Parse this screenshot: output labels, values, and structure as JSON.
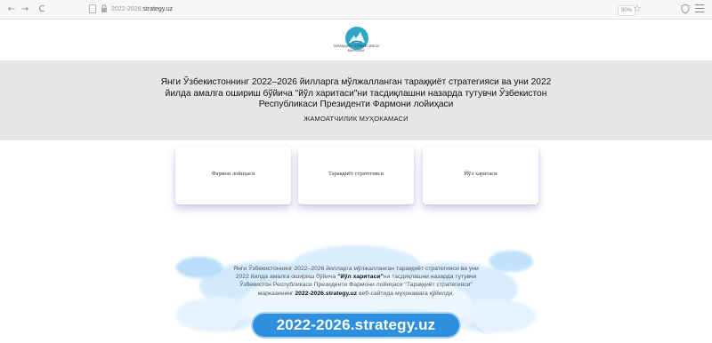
{
  "browser": {
    "address_prefix": "2022-2026.",
    "address_domain": "strategy.uz",
    "zoom": "80%",
    "nav_back": "←",
    "nav_forward": "→",
    "nav_reload": "C",
    "star": "☆",
    "icons": [
      "back-arrow-icon",
      "forward-arrow-icon",
      "reload-icon",
      "page-icon",
      "lock-icon",
      "star-icon",
      "shield-icon",
      "menu-icon"
    ]
  },
  "header": {
    "logo_line1": "ТАРАҚҚИЁТ СТРАТЕГИЯСИ",
    "logo_line2": "МАРКАЗИ"
  },
  "banner": {
    "title": "Янги Ўзбекистоннинг 2022–2026 йилларга мўлжалланган тараққиёт стратегияси ва уни 2022 йилда амалга ошириш бўйича \"йўл харитаси\"ни тасдиқлашни назарда тутувчи Ўзбекистон Республикаси Президенти Фармони лойиҳаси",
    "subtitle": "ЖАМОАТЧИЛИК МУҲОКАМАСИ"
  },
  "cards": [
    {
      "label": "Фармон лойиҳаси"
    },
    {
      "label": "Тараққиёт стратегияси"
    },
    {
      "label": "Йўл харитаси"
    }
  ],
  "promo": {
    "line1": "Янги Ўзбекистоннинг 2022–2026 йилларга мўлжалланган тараққиёт стратегияси ва уни",
    "line2_prefix": "2022 йилда амалга ошириш бўйича ",
    "line2_bold": "\"йўл харитаси\"",
    "line2_suffix": "ни тасдиқлашни назарда тутувчи",
    "line3": "Ўзбекистон Республикаси Президенти Фармони лойиҳаси \"Тараққиёт стратегияси\"",
    "line4_prefix": "марказининг ",
    "line4_bold": "2022-2026.strategy.uz",
    "line4_suffix": " веб-сайтида муҳокамага қўйилди.",
    "domain": "2022-2026.strategy.uz"
  },
  "colors": {
    "banner_bg": "#e6e6e6",
    "accent_blue": "#2d8fde",
    "logo_teal": "#31a7c6"
  }
}
